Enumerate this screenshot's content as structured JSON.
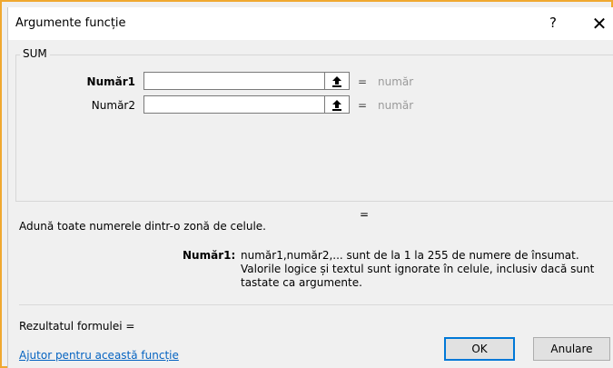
{
  "dialog": {
    "title": "Argumente funcție",
    "help_label": "?",
    "close_label": "✕"
  },
  "function_name": "SUM",
  "arguments": [
    {
      "label": "Număr1",
      "value": "",
      "eq": "=",
      "result": "număr"
    },
    {
      "label": "Număr2",
      "value": "",
      "eq": "=",
      "result": "număr"
    }
  ],
  "function_result_eq": "=",
  "description": "Adună toate numerele dintr-o zonă de celule.",
  "arg_help": {
    "name": "Număr1:",
    "text": "număr1,număr2,... sunt de la 1 la 255 de numere de însumat. Valorile logice și textul sunt ignorate în celule, inclusiv dacă sunt tastate ca argumente."
  },
  "formula_result": "Rezultatul formulei =",
  "help_link": "Ajutor pentru această funcție",
  "buttons": {
    "ok": "OK",
    "cancel": "Anulare"
  },
  "icons": {
    "ref_button": "collapse-dialog-arrow-icon",
    "close": "close-icon"
  },
  "colors": {
    "frame": "#f0a830",
    "link": "#0563c1",
    "default_button_border": "#0078d7"
  }
}
